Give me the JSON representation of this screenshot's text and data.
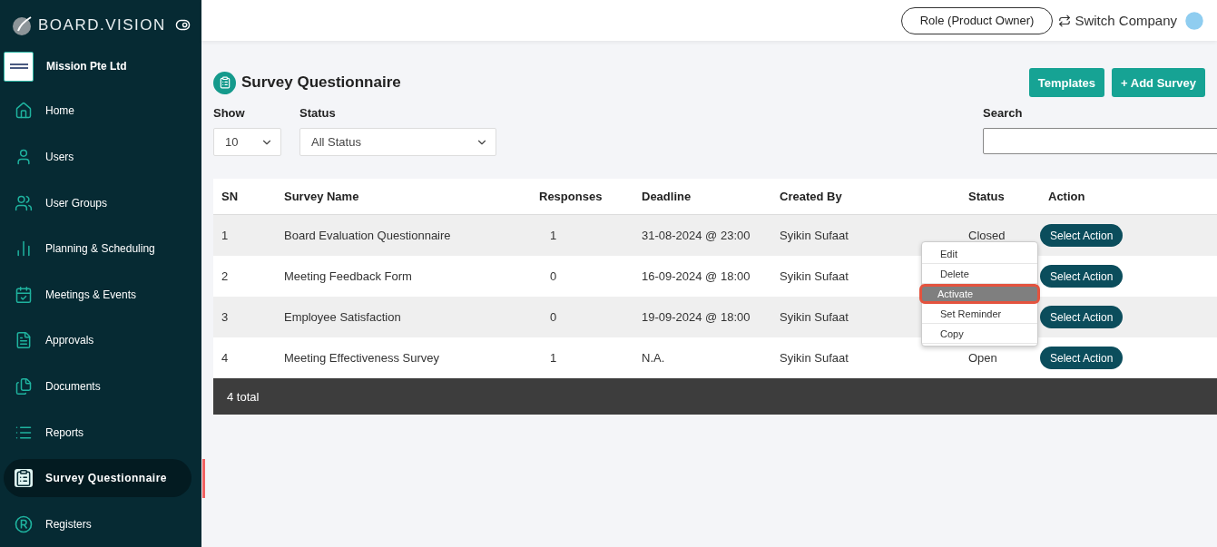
{
  "brand": {
    "name": "BOARD.VISION"
  },
  "company": {
    "name": "Mission Pte Ltd"
  },
  "sidebar": {
    "items": [
      {
        "label": "Home",
        "selected": false
      },
      {
        "label": "Users",
        "selected": false
      },
      {
        "label": "User Groups",
        "selected": false
      },
      {
        "label": "Planning & Scheduling",
        "selected": false
      },
      {
        "label": "Meetings & Events",
        "selected": false
      },
      {
        "label": "Approvals",
        "selected": false
      },
      {
        "label": "Documents",
        "selected": false
      },
      {
        "label": "Reports",
        "selected": false
      },
      {
        "label": "Survey Questionnaire",
        "selected": true
      },
      {
        "label": "Registers",
        "selected": false
      }
    ]
  },
  "topbar": {
    "role": "Role (Product Owner)",
    "switch": "Switch Company"
  },
  "page": {
    "title": "Survey Questionnaire",
    "buttons": [
      "Templates",
      "+ Add Survey"
    ]
  },
  "filters": {
    "show_label": "Show",
    "show_value": "10",
    "status_label": "Status",
    "status_value": "All Status",
    "search_label": "Search"
  },
  "table": {
    "columns": [
      "SN",
      "Survey Name",
      "Responses",
      "Deadline",
      "Created By",
      "Status",
      "Action"
    ],
    "rows": [
      {
        "sn": "1",
        "name": "Board Evaluation Questionnaire",
        "responses": "1",
        "deadline": "31-08-2024 @ 23:00",
        "created_by": "Syikin Sufaat",
        "status": "Closed",
        "action": "Select Action"
      },
      {
        "sn": "2",
        "name": "Meeting Feedback Form",
        "responses": "0",
        "deadline": "16-09-2024 @ 18:00",
        "created_by": "Syikin Sufaat",
        "action": "Select Action"
      },
      {
        "sn": "3",
        "name": "Employee Satisfaction",
        "responses": "0",
        "deadline": "19-09-2024 @ 18:00",
        "created_by": "Syikin Sufaat",
        "action": "Select Action"
      },
      {
        "sn": "4",
        "name": "Meeting Effectiveness Survey",
        "responses": "1",
        "deadline": "N.A.",
        "created_by": "Syikin Sufaat",
        "status": "Open",
        "action": "Select Action"
      }
    ],
    "footer": "4 total"
  },
  "action_menu": {
    "items": [
      {
        "label": "Edit",
        "selected": false
      },
      {
        "label": "Delete",
        "selected": false
      },
      {
        "label": "Activate",
        "selected": true
      },
      {
        "label": "Set Reminder",
        "selected": false
      },
      {
        "label": "Copy",
        "selected": false
      }
    ]
  }
}
